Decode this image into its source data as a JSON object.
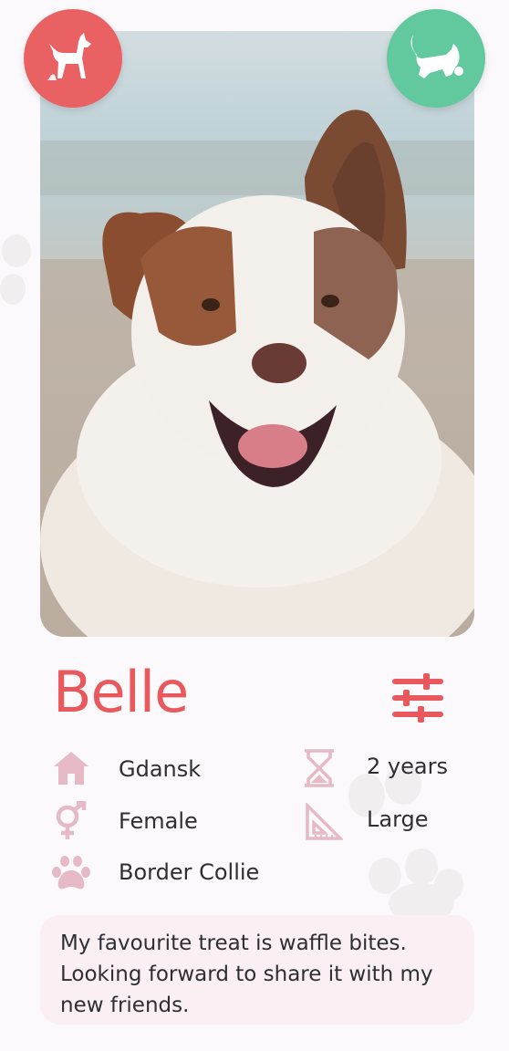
{
  "profile": {
    "name": "Belle",
    "location": "Gdansk",
    "gender": "Female",
    "breed": "Border Collie",
    "age": "2 years",
    "size": "Large",
    "bio": "My favourite treat is waffle bites. Looking forward to share it with my new friends."
  },
  "icons": {
    "dislike": "dog-standing-icon",
    "like": "dog-playing-icon",
    "filter": "sliders-icon",
    "location": "house-icon",
    "gender": "gender-icon",
    "breed": "paw-icon",
    "age": "hourglass-icon",
    "size": "set-square-icon"
  },
  "colors": {
    "accent": "#e8585c",
    "dislike": "#ea6163",
    "like": "#62c99e",
    "icon_pink": "#e6b9c6",
    "bio_bg": "#faeff2",
    "text": "#2e2e35"
  }
}
